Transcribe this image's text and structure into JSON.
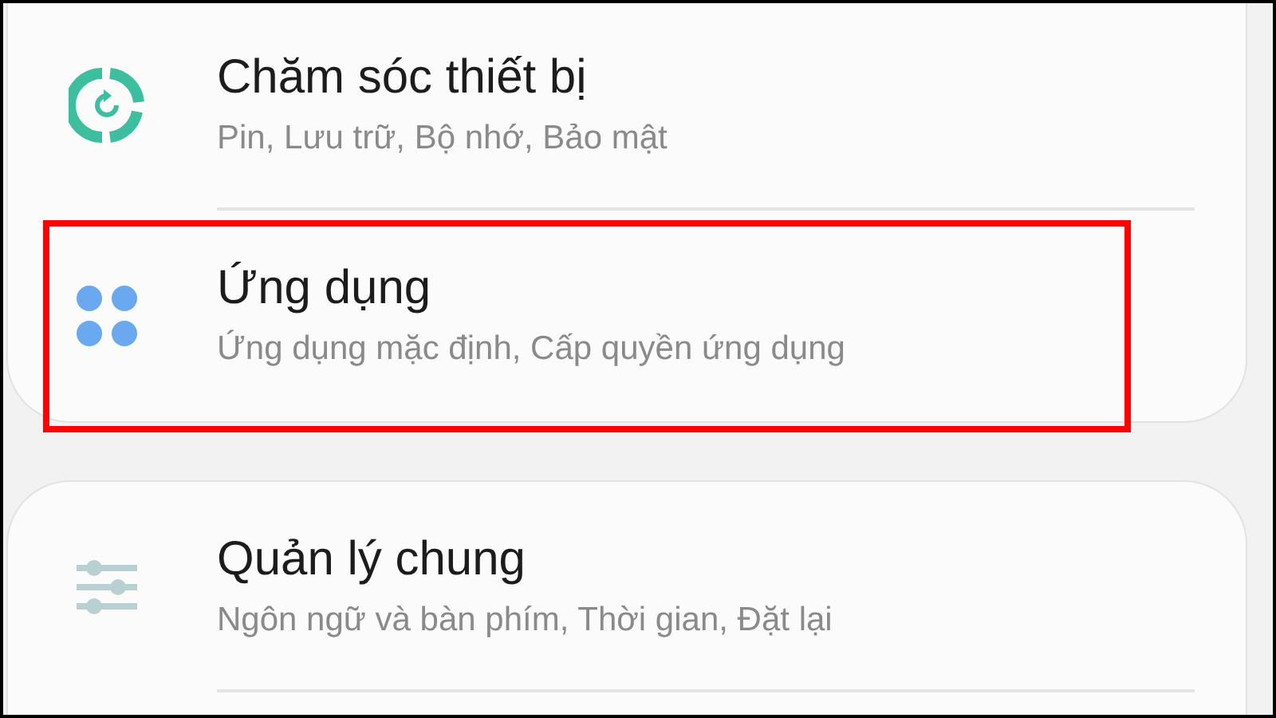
{
  "cards": [
    {
      "items": [
        {
          "kind": "care",
          "title": "Chăm sóc thiết bị",
          "subtitle": "Pin, Lưu trữ, Bộ nhớ, Bảo mật",
          "highlighted": false
        },
        {
          "kind": "apps",
          "title": "Ứng dụng",
          "subtitle": "Ứng dụng mặc định, Cấp quyền ứng dụng",
          "highlighted": true
        }
      ]
    },
    {
      "items": [
        {
          "kind": "general",
          "title": "Quản lý chung",
          "subtitle": "Ngôn ngữ và bàn phím, Thời gian, Đặt lại",
          "highlighted": false
        }
      ]
    }
  ]
}
